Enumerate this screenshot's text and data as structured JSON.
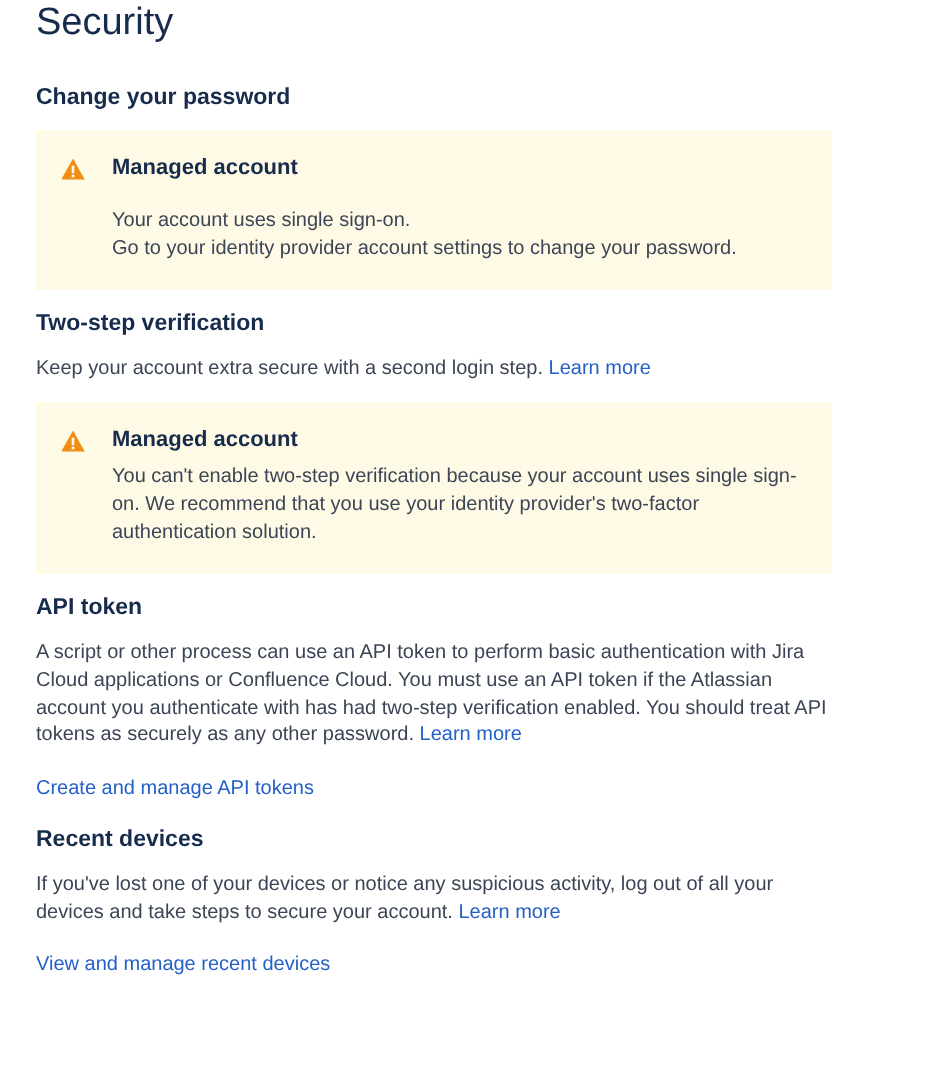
{
  "title": "Security",
  "sections": [
    {
      "heading": "Change your password",
      "warning": {
        "title": "Managed account",
        "lines": [
          "Your account uses single sign-on.",
          "Go to your identity provider account settings to change your password."
        ]
      }
    },
    {
      "heading": "Two-step verification",
      "description": "Keep your account extra secure with a second login step.",
      "learn_more": "Learn more",
      "warning": {
        "title": "Managed account",
        "lines": [
          "You can't enable two-step verification because your account uses single sign-on. We recommend that you use your identity provider's two-factor authentication solution."
        ]
      }
    },
    {
      "heading": "API token",
      "description": "A script or other process can use an API token to perform basic authentication with Jira Cloud applications or Confluence Cloud. You must use an API token if the Atlassian account you authenticate with has had two-step verification enabled. You should treat API tokens as securely as any other password.",
      "learn_more": "Learn more",
      "action": "Create and manage API tokens"
    },
    {
      "heading": "Recent devices",
      "description": "If you've lost one of your devices or notice any suspicious activity, log out of all your devices and take steps to secure your account.",
      "learn_more": "Learn more",
      "action": "View and manage recent devices"
    }
  ]
}
